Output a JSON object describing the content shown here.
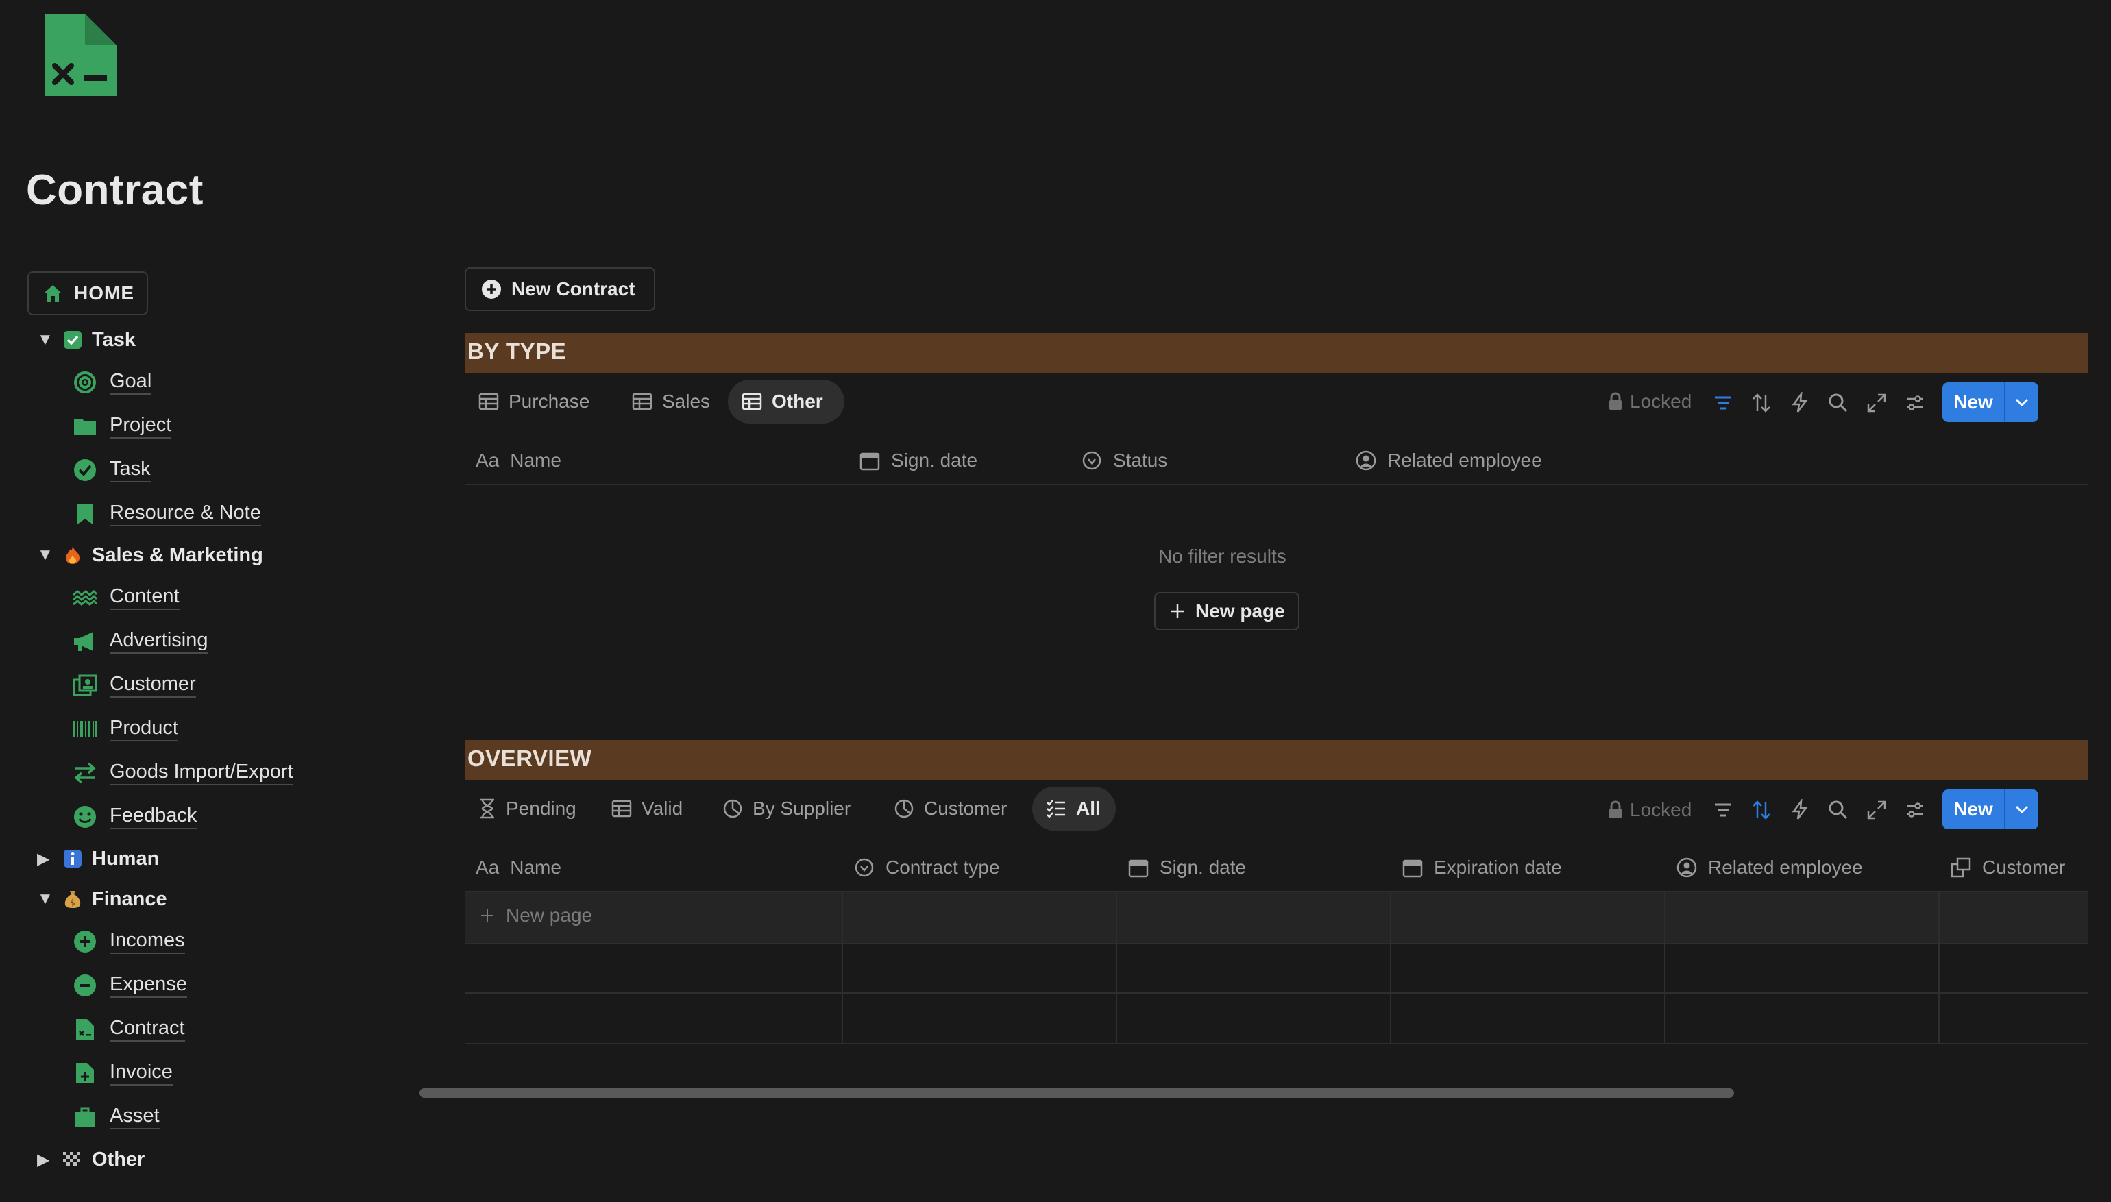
{
  "page": {
    "title": "Contract"
  },
  "sidebar": {
    "home": "HOME",
    "groups": [
      {
        "label": "Task",
        "expanded": "▼",
        "items": [
          "Goal",
          "Project",
          "Task",
          "Resource & Note"
        ]
      },
      {
        "label": "Sales & Marketing",
        "expanded": "▼",
        "items": [
          "Content",
          "Advertising",
          "Customer",
          "Product",
          "Goods Import/Export",
          "Feedback"
        ]
      },
      {
        "label": "Human",
        "expanded": "▶",
        "items": []
      },
      {
        "label": "Finance",
        "expanded": "▼",
        "items": [
          "Incomes",
          "Expense",
          "Contract",
          "Invoice",
          "Asset"
        ]
      },
      {
        "label": "Other",
        "expanded": "▶",
        "items": []
      }
    ]
  },
  "actions": {
    "new_contract": "New Contract"
  },
  "by_type": {
    "heading": "BY TYPE",
    "tabs": [
      "Purchase",
      "Sales",
      "Other"
    ],
    "active_tab": "Other",
    "locked_label": "Locked",
    "new_label": "New",
    "columns": [
      "Name",
      "Sign. date",
      "Status",
      "Related employee"
    ],
    "empty_message": "No filter results",
    "new_page_label": "New page"
  },
  "overview": {
    "heading": "OVERVIEW",
    "tabs": [
      "Pending",
      "Valid",
      "By Supplier",
      "Customer",
      "All"
    ],
    "active_tab": "All",
    "locked_label": "Locked",
    "new_label": "New",
    "columns": [
      "Name",
      "Contract type",
      "Sign. date",
      "Expiration date",
      "Related employee",
      "Customer"
    ],
    "new_page_label": "New page"
  },
  "colors": {
    "accent_blue": "#2f7de1",
    "section_bar": "#5a3b22",
    "icon_green": "#3aa35f",
    "background": "#191919"
  }
}
